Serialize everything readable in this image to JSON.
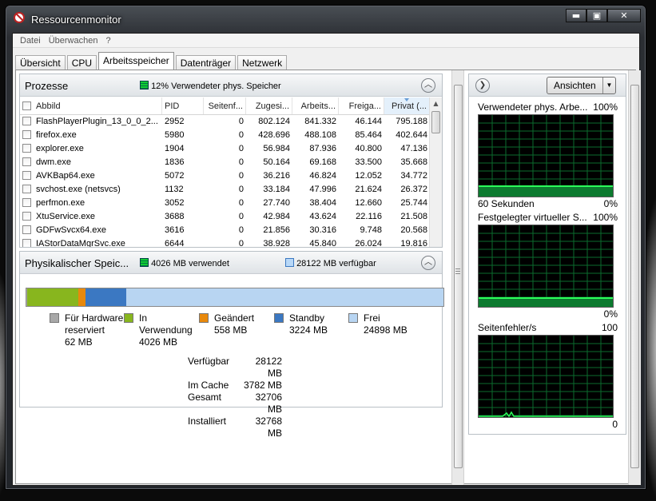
{
  "window": {
    "title": "Ressourcenmonitor",
    "min": "▬",
    "max": "▣",
    "close": "✕"
  },
  "menu": [
    "Datei",
    "Überwachen",
    "?"
  ],
  "tabs": [
    "Übersicht",
    "CPU",
    "Arbeitsspeicher",
    "Datenträger",
    "Netzwerk"
  ],
  "active_tab": "Arbeitsspeicher",
  "processes": {
    "title": "Prozesse",
    "info": "12% Verwendeter phys. Speicher",
    "columns": [
      "Abbild",
      "PID",
      "Seitenf...",
      "Zugesi...",
      "Arbeits...",
      "Freiga...",
      "Privat (..."
    ],
    "rows": [
      [
        "FlashPlayerPlugin_13_0_0_2...",
        "2952",
        "0",
        "802.124",
        "841.332",
        "46.144",
        "795.188"
      ],
      [
        "firefox.exe",
        "5980",
        "0",
        "428.696",
        "488.108",
        "85.464",
        "402.644"
      ],
      [
        "explorer.exe",
        "1904",
        "0",
        "56.984",
        "87.936",
        "40.800",
        "47.136"
      ],
      [
        "dwm.exe",
        "1836",
        "0",
        "50.164",
        "69.168",
        "33.500",
        "35.668"
      ],
      [
        "AVKBap64.exe",
        "5072",
        "0",
        "36.216",
        "46.824",
        "12.052",
        "34.772"
      ],
      [
        "svchost.exe (netsvcs)",
        "1132",
        "0",
        "33.184",
        "47.996",
        "21.624",
        "26.372"
      ],
      [
        "perfmon.exe",
        "3052",
        "0",
        "27.740",
        "38.404",
        "12.660",
        "25.744"
      ],
      [
        "XtuService.exe",
        "3688",
        "0",
        "42.984",
        "43.624",
        "22.116",
        "21.508"
      ],
      [
        "GDFwSvcx64.exe",
        "3616",
        "0",
        "21.856",
        "30.316",
        "9.748",
        "20.568"
      ],
      [
        "IAStorDataMgrSvc.exe",
        "6644",
        "0",
        "38.928",
        "45.840",
        "26.024",
        "19.816"
      ]
    ]
  },
  "physical": {
    "title": "Physikalischer Speic...",
    "used": "4026 MB verwendet",
    "available": "28122 MB verfügbar",
    "legend": [
      {
        "label": "Für Hardware reserviert",
        "value": "62 MB",
        "color": "#a8a8a8"
      },
      {
        "label": "In Verwendung",
        "value": "4026 MB",
        "color": "#88b61e"
      },
      {
        "label": "Geändert",
        "value": "558 MB",
        "color": "#e8890c"
      },
      {
        "label": "Standby",
        "value": "3224 MB",
        "color": "#3b78c2"
      },
      {
        "label": "Frei",
        "value": "24898 MB",
        "color": "#b8d5f2"
      }
    ],
    "bar_fractions": {
      "hardware": 0.0019,
      "in_use": 0.1229,
      "modified": 0.017,
      "standby": 0.0984,
      "free": 0.7598
    },
    "stats": [
      {
        "label": "Verfügbar",
        "value": "28122 MB"
      },
      {
        "label": "Im Cache",
        "value": "3782 MB"
      },
      {
        "label": "Gesamt",
        "value": "32706 MB"
      },
      {
        "label": "Installiert",
        "value": "32768 MB"
      }
    ]
  },
  "graphs": {
    "view_button": "Ansichten",
    "items": [
      {
        "title": "Verwendeter phys. Arbe...",
        "max": "100%",
        "min": "0%",
        "footer": "60 Sekunden"
      },
      {
        "title": "Festgelegter virtueller S...",
        "max": "100%",
        "min": "0%"
      },
      {
        "title": "Seitenfehler/s",
        "max": "100",
        "min": "0"
      }
    ]
  }
}
